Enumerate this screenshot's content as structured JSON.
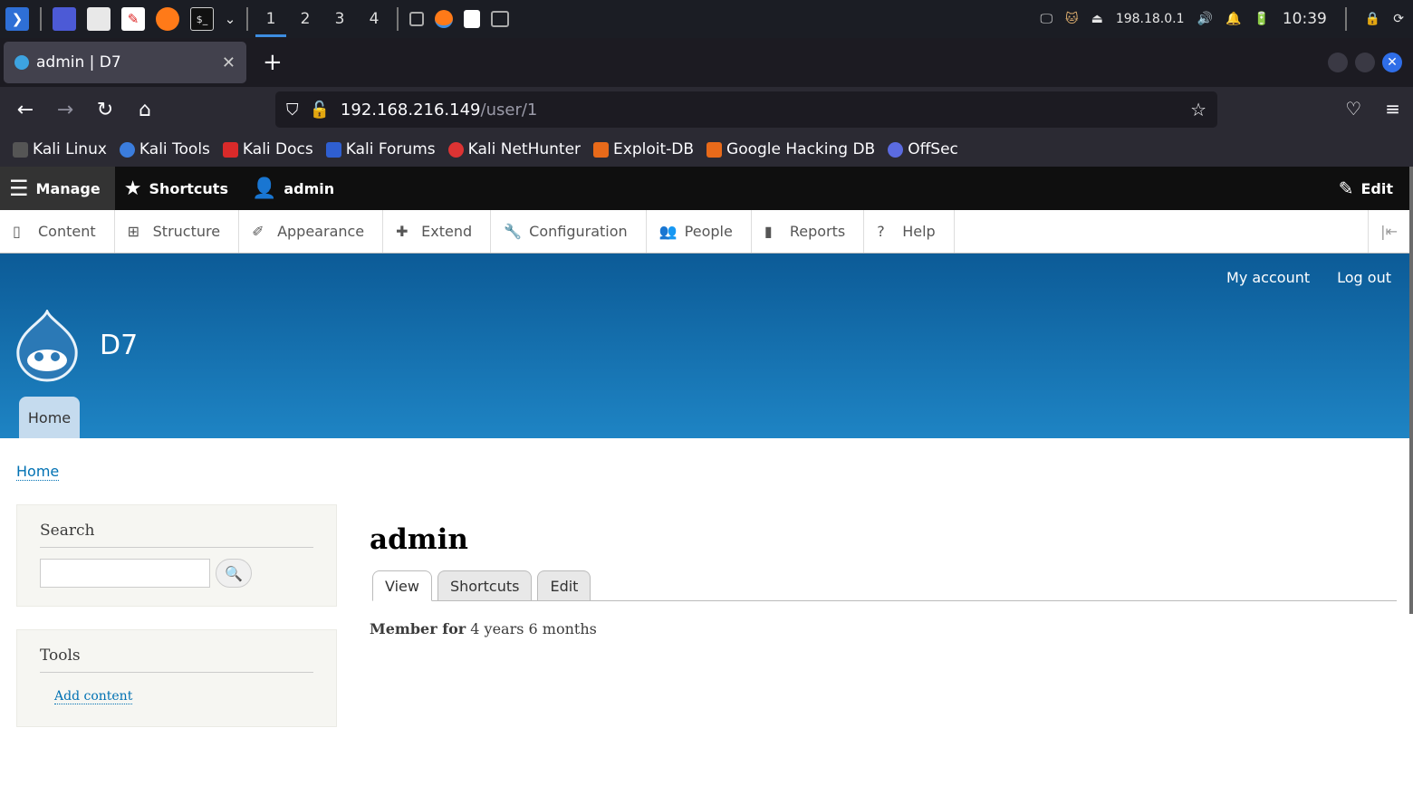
{
  "taskbar": {
    "workspaces": [
      "1",
      "2",
      "3",
      "4"
    ],
    "ip": "198.18.0.1",
    "clock": "10:39"
  },
  "browser": {
    "tab_title": "admin | D7",
    "url_host": "192.168.216.149",
    "url_path": "/user/1",
    "bookmarks": [
      "Kali Linux",
      "Kali Tools",
      "Kali Docs",
      "Kali Forums",
      "Kali NetHunter",
      "Exploit-DB",
      "Google Hacking DB",
      "OffSec"
    ]
  },
  "admin_bar": {
    "manage": "Manage",
    "shortcuts": "Shortcuts",
    "user": "admin",
    "edit": "Edit"
  },
  "admin_menu": [
    "Content",
    "Structure",
    "Appearance",
    "Extend",
    "Configuration",
    "People",
    "Reports",
    "Help"
  ],
  "site": {
    "name": "D7",
    "my_account": "My account",
    "log_out": "Log out",
    "home_tab": "Home"
  },
  "breadcrumb": "Home",
  "sidebar": {
    "search_title": "Search",
    "tools_title": "Tools",
    "add_content": "Add content"
  },
  "main": {
    "title": "admin",
    "tabs": [
      "View",
      "Shortcuts",
      "Edit"
    ],
    "member_label": "Member for",
    "member_value": "4 years 6 months"
  }
}
